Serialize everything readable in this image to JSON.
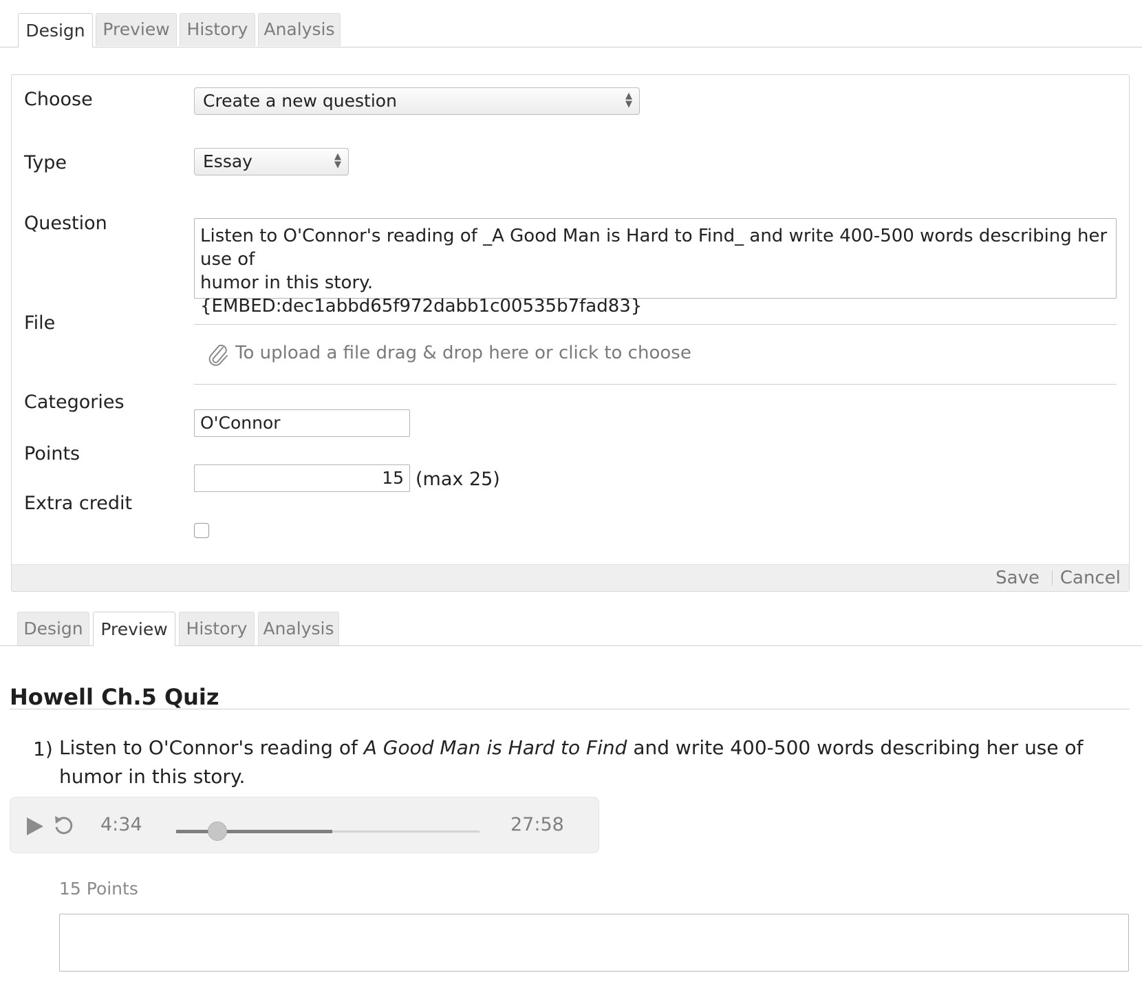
{
  "design_tabs": [
    {
      "label": "Design",
      "active": true
    },
    {
      "label": "Preview",
      "active": false
    },
    {
      "label": "History",
      "active": false
    },
    {
      "label": "Analysis",
      "active": false
    }
  ],
  "form": {
    "choose": {
      "label": "Choose",
      "value": "Create a new question"
    },
    "type": {
      "label": "Type",
      "value": "Essay"
    },
    "question": {
      "label": "Question",
      "line1": "Listen to O'Connor's reading of _A Good Man is Hard to Find_ and write 400-500 words describing her use of",
      "line2": "humor in this story.",
      "line3": "{EMBED:dec1abbd65f972dabb1c00535b7fad83}"
    },
    "file": {
      "label": "File",
      "hint": "To upload a file drag & drop here or click to choose",
      "icon": "paperclip-icon"
    },
    "categories": {
      "label": "Categories",
      "value": "O'Connor"
    },
    "points": {
      "label": "Points",
      "value": "15",
      "max_text": "(max 25)"
    },
    "extra_credit": {
      "label": "Extra credit",
      "checked": false
    },
    "save_label": "Save",
    "cancel_label": "Cancel"
  },
  "preview_tabs": [
    {
      "label": "Design",
      "active": false
    },
    {
      "label": "Preview",
      "active": true
    },
    {
      "label": "History",
      "active": false
    },
    {
      "label": "Analysis",
      "active": false
    }
  ],
  "preview": {
    "quiz_title": "Howell Ch.5 Quiz",
    "question_number": "1)",
    "question_before": "Listen to O'Connor's reading of ",
    "question_title": "A Good Man is Hard to Find",
    "question_after": " and write 400-500 words describing her use of humor in this story.",
    "audio": {
      "current_time": "4:34",
      "duration": "27:58",
      "progress_fraction": 0.135,
      "buffered_fraction": 0.515
    },
    "points_text": "15 Points"
  }
}
